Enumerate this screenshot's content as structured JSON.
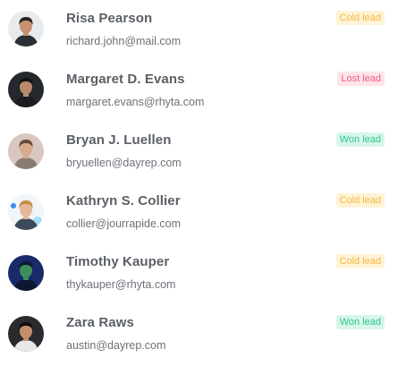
{
  "leads": [
    {
      "name": "Risa Pearson",
      "email": "richard.john@mail.com",
      "status": "Cold lead",
      "status_type": "cold",
      "avatar": "risa-pearson-avatar",
      "colors": {
        "bg": "#e8ebee",
        "skin": "#c9916f",
        "hair": "#2a2420",
        "shirt": "#2b2f36"
      }
    },
    {
      "name": "Margaret D. Evans",
      "email": "margaret.evans@rhyta.com",
      "status": "Lost lead",
      "status_type": "lost",
      "avatar": "margaret-evans-avatar",
      "colors": {
        "bg": "#25282c",
        "skin": "#b88a6c",
        "hair": "#141414",
        "shirt": "#1a1c1f"
      }
    },
    {
      "name": "Bryan J. Luellen",
      "email": "bryuellen@dayrep.com",
      "status": "Won lead",
      "status_type": "won",
      "avatar": "bryan-luellen-avatar",
      "colors": {
        "bg": "#d9c8c0",
        "skin": "#d8a98c",
        "hair": "#6b4a35",
        "shirt": "#8a7c74"
      }
    },
    {
      "name": "Kathryn S. Collier",
      "email": "collier@jourrapide.com",
      "status": "Cold lead",
      "status_type": "cold",
      "avatar": "kathryn-collier-avatar",
      "colors": {
        "bg": "#f1f4f8",
        "skin": "#e4b89a",
        "hair": "#c98c4a",
        "shirt": "#3c4a5a",
        "accent": "#3a8ef0"
      }
    },
    {
      "name": "Timothy Kauper",
      "email": "thykauper@rhyta.com",
      "status": "Cold lead",
      "status_type": "cold",
      "avatar": "timothy-kauper-avatar",
      "colors": {
        "bg": "#182a6a",
        "skin": "#3c8f5c",
        "hair": "#0f1a2e",
        "shirt": "#0d1730"
      }
    },
    {
      "name": "Zara Raws",
      "email": "austin@dayrep.com",
      "status": "Won lead",
      "status_type": "won",
      "avatar": "zara-raws-avatar",
      "colors": {
        "bg": "#2a2b2e",
        "skin": "#c48f6a",
        "hair": "#111111",
        "shirt": "#e8e8e8"
      }
    }
  ]
}
